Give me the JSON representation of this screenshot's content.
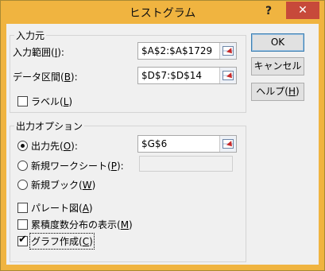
{
  "window": {
    "title": "ヒストグラム",
    "help_glyph": "?",
    "close_glyph": "✕"
  },
  "input_group": {
    "title": "入力元",
    "input_range": {
      "label": "入力範囲(",
      "accel": "I",
      "suffix": "):",
      "value": "$A$2:$A$1729"
    },
    "bin_range": {
      "label": "データ区間(",
      "accel": "B",
      "suffix": "):",
      "value": "$D$7:$D$14"
    },
    "labels": {
      "label": "ラベル(",
      "accel": "L",
      "suffix": ")",
      "checked": false
    }
  },
  "output_group": {
    "title": "出力オプション",
    "output_range": {
      "label": "出力先(",
      "accel": "O",
      "suffix": "):",
      "value": "$G$6",
      "selected": true
    },
    "new_worksheet": {
      "label": "新規ワークシート(",
      "accel": "P",
      "suffix": "):",
      "value": "",
      "selected": false
    },
    "new_workbook": {
      "label": "新規ブック(",
      "accel": "W",
      "suffix": ")",
      "selected": false
    },
    "pareto": {
      "label": "パレート図(",
      "accel": "A",
      "suffix": ")",
      "checked": false
    },
    "cumulative": {
      "label": "累積度数分布の表示(",
      "accel": "M",
      "suffix": ")",
      "checked": false
    },
    "chart_output": {
      "label": "グラフ作成(",
      "accel": "C",
      "suffix": ")",
      "checked": true,
      "check_glyph": "✔"
    }
  },
  "buttons": {
    "ok": "OK",
    "cancel": "キャンセル",
    "help": {
      "label": "ヘルプ(",
      "accel": "H",
      "suffix": ")"
    }
  },
  "colors": {
    "titlebar": "#f0b440",
    "close": "#c7493a",
    "dialog_bg": "#f0f0f0"
  }
}
